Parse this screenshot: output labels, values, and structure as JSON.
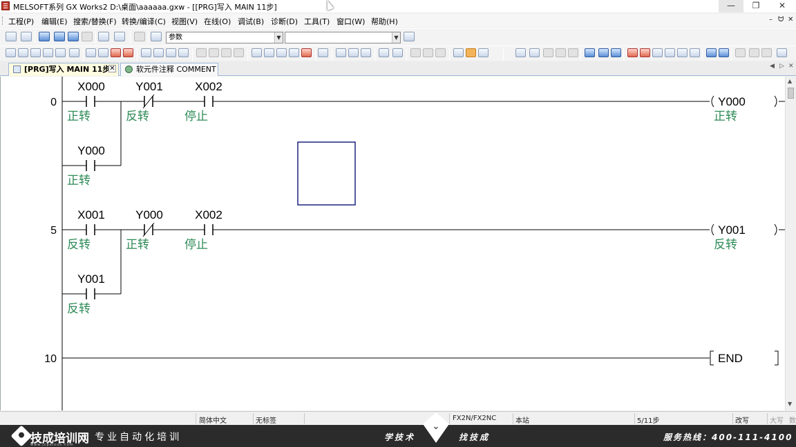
{
  "window": {
    "title": "MELSOFT系列 GX Works2 D:\\桌面\\aaaaaa.gxw - [[PRG]写入 MAIN 11步]",
    "min_glyph": "—",
    "max_glyph": "❐",
    "close_glyph": "✕"
  },
  "menu": {
    "items": [
      "工程(P)",
      "编辑(E)",
      "搜索/替换(F)",
      "转换/编译(C)",
      "视图(V)",
      "在线(O)",
      "调试(B)",
      "诊断(D)",
      "工具(T)",
      "窗口(W)",
      "帮助(H)"
    ],
    "mdi_controls": [
      "–",
      "ᗢ",
      "✕"
    ]
  },
  "toolbar": {
    "combo_label": "参数",
    "combo2_value": ""
  },
  "tabs": [
    {
      "label": "[PRG]写入 MAIN 11步",
      "active": true
    },
    {
      "label": "软元件注释 COMMENT",
      "active": false
    }
  ],
  "tab_nav": [
    "◀",
    "▷",
    "✕"
  ],
  "ladder": {
    "rungs": [
      {
        "step": "0",
        "contacts": [
          {
            "device": "X000",
            "comment": "正转",
            "type": "NO"
          },
          {
            "device": "Y001",
            "comment": "反转",
            "type": "NC"
          },
          {
            "device": "X002",
            "comment": "停止",
            "type": "NO"
          }
        ],
        "branch": {
          "device": "Y000",
          "comment": "正转",
          "type": "NO"
        },
        "coil": {
          "device": "Y000",
          "comment": "正转"
        }
      },
      {
        "step": "5",
        "contacts": [
          {
            "device": "X001",
            "comment": "反转",
            "type": "NO"
          },
          {
            "device": "Y000",
            "comment": "正转",
            "type": "NC"
          },
          {
            "device": "X002",
            "comment": "停止",
            "type": "NO"
          }
        ],
        "branch": {
          "device": "Y001",
          "comment": "反转",
          "type": "NO"
        },
        "coil": {
          "device": "Y001",
          "comment": "反转"
        }
      },
      {
        "step": "10",
        "end_label": "END"
      }
    ],
    "colors": {
      "device_text": "#000000",
      "comment_text": "#2e8b57",
      "line": "#000000",
      "cursor_box": "#1a237e"
    }
  },
  "scroll": {
    "up": "▲",
    "down": "▼"
  },
  "status": {
    "language": "简体中文",
    "label": "无标签",
    "plc": "FX2N/FX2NC",
    "station": "本站",
    "steps": "5/11步",
    "mode": "改写",
    "caps": "大写",
    "num": "数"
  },
  "footer": {
    "brand": "技成培训网",
    "url": "www.jcpeixun.com",
    "slogan": "| 专业自动化培训",
    "left_phrase": "学技术",
    "right_phrase": "找技成",
    "hotline": "服务热线：400-111-4100"
  }
}
